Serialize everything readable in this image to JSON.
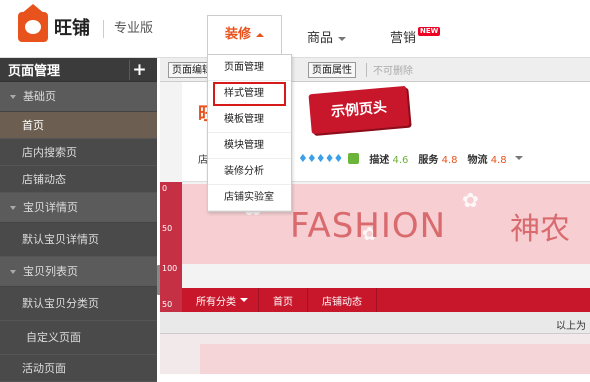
{
  "brand": {
    "logo_text": "旺铺",
    "edition": "专业版"
  },
  "topnav": {
    "active": "装修",
    "items": [
      {
        "label": "商品"
      },
      {
        "label": "营销",
        "badge": "NEW"
      }
    ]
  },
  "sidebar": {
    "title": "页面管理",
    "add": "+",
    "groups": [
      {
        "label": "基础页",
        "items": [
          {
            "label": "首页"
          },
          {
            "label": "店内搜索页"
          },
          {
            "label": "店铺动态"
          }
        ]
      },
      {
        "label": "宝贝详情页",
        "items": [
          {
            "label": "默认宝贝详情页"
          }
        ]
      },
      {
        "label": "宝贝列表页",
        "items": [
          {
            "label": "默认宝贝分类页"
          }
        ]
      }
    ],
    "custom": "自定义页面",
    "partial": "活动页面"
  },
  "toolbar": {
    "edit": "页面编辑",
    "props": "页面属性",
    "delete": "不可删除"
  },
  "dropdown": {
    "items": [
      "页面管理",
      "样式管理",
      "模板管理",
      "模块管理",
      "装修分析",
      "店铺实验室"
    ]
  },
  "shop": {
    "logo_char": "旺",
    "title_tag": "店",
    "ribbon": "示例页头",
    "diamonds": "♦♦♦♦♦",
    "desc": "描述",
    "desc_v": "4.6",
    "service": "服务",
    "service_v": "4.8",
    "logistics": "物流",
    "logistics_v": "4.8",
    "banner_en": "FASHION",
    "banner_cn": "神农",
    "nav": [
      "所有分类",
      "首页",
      "店铺动态"
    ],
    "strip": "以上为"
  },
  "ruler": {
    "ticks": [
      "0",
      "50",
      "100",
      "50"
    ]
  }
}
